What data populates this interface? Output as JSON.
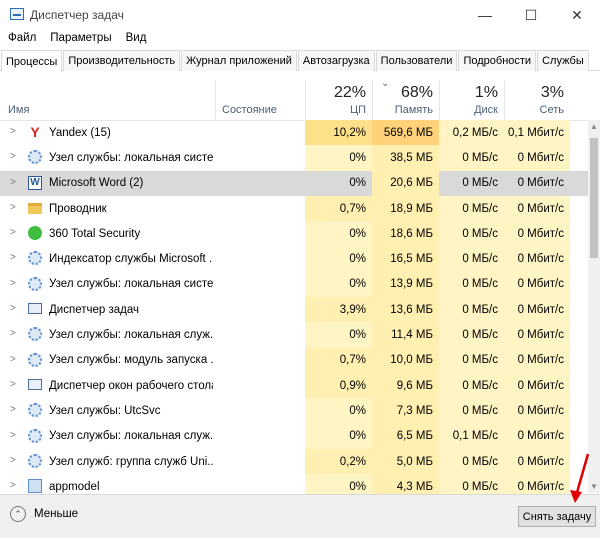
{
  "window": {
    "title": "Диспетчер задач",
    "minimize": "—",
    "maximize": "☐",
    "close": "✕"
  },
  "menu": [
    "Файл",
    "Параметры",
    "Вид"
  ],
  "tabs": [
    "Процессы",
    "Производительность",
    "Журнал приложений",
    "Автозагрузка",
    "Пользователи",
    "Подробности",
    "Службы"
  ],
  "columns": {
    "name": "Имя",
    "status": "Состояние",
    "cpu": {
      "pct": "22%",
      "label": "ЦП"
    },
    "mem": {
      "pct": "68%",
      "label": "Память"
    },
    "disk": {
      "pct": "1%",
      "label": "Диск"
    },
    "net": {
      "pct": "3%",
      "label": "Сеть"
    }
  },
  "rows": [
    {
      "icon": "yandex-icon",
      "name": "Yandex (15)",
      "cpu": "10,2%",
      "mem": "569,6 МБ",
      "disk": "0,2 МБ/с",
      "net": "0,1 Мбит/с",
      "cpuHeat": 2,
      "memHeat": 3
    },
    {
      "icon": "gear-icon",
      "name": "Узел службы: локальная систе...",
      "cpu": "0%",
      "mem": "38,5 МБ",
      "disk": "0 МБ/с",
      "net": "0 Мбит/с",
      "cpuHeat": 0,
      "memHeat": 1
    },
    {
      "icon": "word-icon",
      "name": "Microsoft Word (2)",
      "cpu": "0%",
      "mem": "20,6 МБ",
      "disk": "0 МБ/с",
      "net": "0 Мбит/с",
      "cpuHeat": 0,
      "memHeat": 1,
      "selected": true
    },
    {
      "icon": "folder-icon",
      "name": "Проводник",
      "cpu": "0,7%",
      "mem": "18,9 МБ",
      "disk": "0 МБ/с",
      "net": "0 Мбит/с",
      "cpuHeat": 1,
      "memHeat": 1
    },
    {
      "icon": "security-icon",
      "name": "360 Total Security",
      "cpu": "0%",
      "mem": "18,6 МБ",
      "disk": "0 МБ/с",
      "net": "0 Мбит/с",
      "cpuHeat": 0,
      "memHeat": 1
    },
    {
      "icon": "indexer-icon",
      "name": "Индексатор службы Microsoft ...",
      "cpu": "0%",
      "mem": "16,5 МБ",
      "disk": "0 МБ/с",
      "net": "0 Мбит/с",
      "cpuHeat": 0,
      "memHeat": 1
    },
    {
      "icon": "gear-icon",
      "name": "Узел службы: локальная систе...",
      "cpu": "0%",
      "mem": "13,9 МБ",
      "disk": "0 МБ/с",
      "net": "0 Мбит/с",
      "cpuHeat": 0,
      "memHeat": 1
    },
    {
      "icon": "taskmgr-icon",
      "name": "Диспетчер задач",
      "cpu": "3,9%",
      "mem": "13,6 МБ",
      "disk": "0 МБ/с",
      "net": "0 Мбит/с",
      "cpuHeat": 1,
      "memHeat": 1
    },
    {
      "icon": "gear-icon",
      "name": "Узел службы: локальная служ...",
      "cpu": "0%",
      "mem": "11,4 МБ",
      "disk": "0 МБ/с",
      "net": "0 Мбит/с",
      "cpuHeat": 0,
      "memHeat": 1
    },
    {
      "icon": "gear-icon",
      "name": "Узел службы: модуль запуска ...",
      "cpu": "0,7%",
      "mem": "10,0 МБ",
      "disk": "0 МБ/с",
      "net": "0 Мбит/с",
      "cpuHeat": 1,
      "memHeat": 1
    },
    {
      "icon": "dwm-icon",
      "name": "Диспетчер окон рабочего стола",
      "cpu": "0,9%",
      "mem": "9,6 МБ",
      "disk": "0 МБ/с",
      "net": "0 Мбит/с",
      "cpuHeat": 1,
      "memHeat": 1
    },
    {
      "icon": "gear-icon",
      "name": "Узел службы: UtcSvc",
      "cpu": "0%",
      "mem": "7,3 МБ",
      "disk": "0 МБ/с",
      "net": "0 Мбит/с",
      "cpuHeat": 0,
      "memHeat": 1
    },
    {
      "icon": "gear-icon",
      "name": "Узел службы: локальная служ...",
      "cpu": "0%",
      "mem": "6,5 МБ",
      "disk": "0,1 МБ/с",
      "net": "0 Мбит/с",
      "cpuHeat": 0,
      "memHeat": 1
    },
    {
      "icon": "gear-icon",
      "name": "Узел служб: группа служб Uni...",
      "cpu": "0,2%",
      "mem": "5,0 МБ",
      "disk": "0 МБ/с",
      "net": "0 Мбит/с",
      "cpuHeat": 1,
      "memHeat": 1
    },
    {
      "icon": "app-icon",
      "name": "appmodel",
      "cpu": "0%",
      "mem": "4,3 МБ",
      "disk": "0 МБ/с",
      "net": "0 Мбит/с",
      "cpuHeat": 0,
      "memHeat": 1
    }
  ],
  "footer": {
    "less": "Меньше",
    "endTask": "Снять задачу"
  },
  "colors": {
    "heat0": "#fff4c4",
    "heat1": "#ffefb0",
    "heat2": "#ffe08a",
    "heat3": "#ffd27a",
    "heatLight": "#fff9e0",
    "selected": "#d9d9d9",
    "arrow": "#e00000"
  }
}
